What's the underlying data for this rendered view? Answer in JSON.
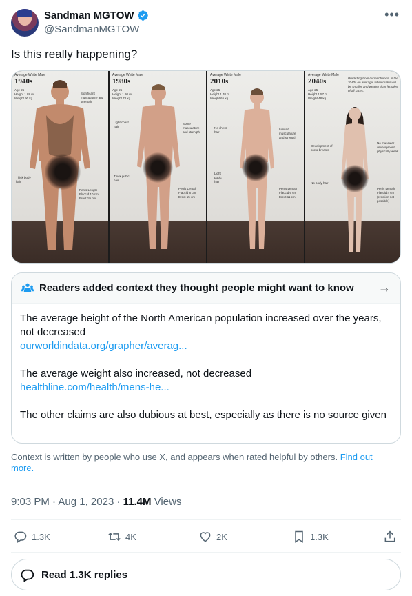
{
  "author": {
    "name": "Sandman MGTOW",
    "handle": "@SandmanMGTOW",
    "avatar_icon": "avatar-photo",
    "verified_color": "#1d9bf0"
  },
  "tweet": {
    "text": "Is this really happening?"
  },
  "media": {
    "panels": [
      {
        "label": "Average White Male",
        "era": "1940s",
        "stats": "Age 25\nHeight 1.88 m\nWeight 90 kg",
        "notes": [
          "Significant musculature and strength",
          "Thick body hair",
          "Penis Length Flaccid 10 cm Erect 19 cm"
        ]
      },
      {
        "label": "Average White Male",
        "era": "1980s",
        "stats": "Age 25\nHeight 1.80 m\nWeight 78 kg",
        "notes": [
          "Light chest hair",
          "Some musculature and strength",
          "Thick pubic hair",
          "Penis Length Flaccid 8 cm Erect 15 cm"
        ]
      },
      {
        "label": "Average White Male",
        "era": "2010s",
        "stats": "Age 25\nHeight 1.70 m\nWeight 65 kg",
        "notes": [
          "No chest hair",
          "Limited musculature and strength",
          "Light pubic hair",
          "Penis Length Flaccid 6 cm Erect 11 cm"
        ]
      },
      {
        "label": "Average White Male",
        "era": "2040s",
        "stats": "Age 25\nHeight 1.57 m\nWeight 48 kg",
        "notes": [
          "Predicting from current trends, in the 2040s on average, white males will be smaller and weaker than females of all races.",
          "Development of proto-breasts",
          "No muscular development; physically weak",
          "No body hair",
          "Penis Length Flaccid 4 cm (erection not possible)"
        ]
      }
    ]
  },
  "community_note": {
    "header": "Readers added context they thought people might want to know",
    "paragraph1": "The average height of the North American population increased over the years, not decreased",
    "link1": "ourworldindata.org/grapher/averag...",
    "paragraph2": "The average weight also increased, not decreased",
    "link2": "healthline.com/health/mens-he...",
    "paragraph3": "The other claims are also dubious at best, especially as there is no source given"
  },
  "context_footer": {
    "text": "Context is written by people who use X, and appears when rated helpful by others.",
    "link": "Find out more."
  },
  "meta": {
    "time": "9:03 PM",
    "date": "Aug 1, 2023",
    "views_count": "11.4M",
    "views_label": "Views"
  },
  "actions": {
    "replies": "1.3K",
    "reposts": "4K",
    "likes": "2K",
    "bookmarks": "1.3K"
  },
  "read_replies": "Read 1.3K replies"
}
